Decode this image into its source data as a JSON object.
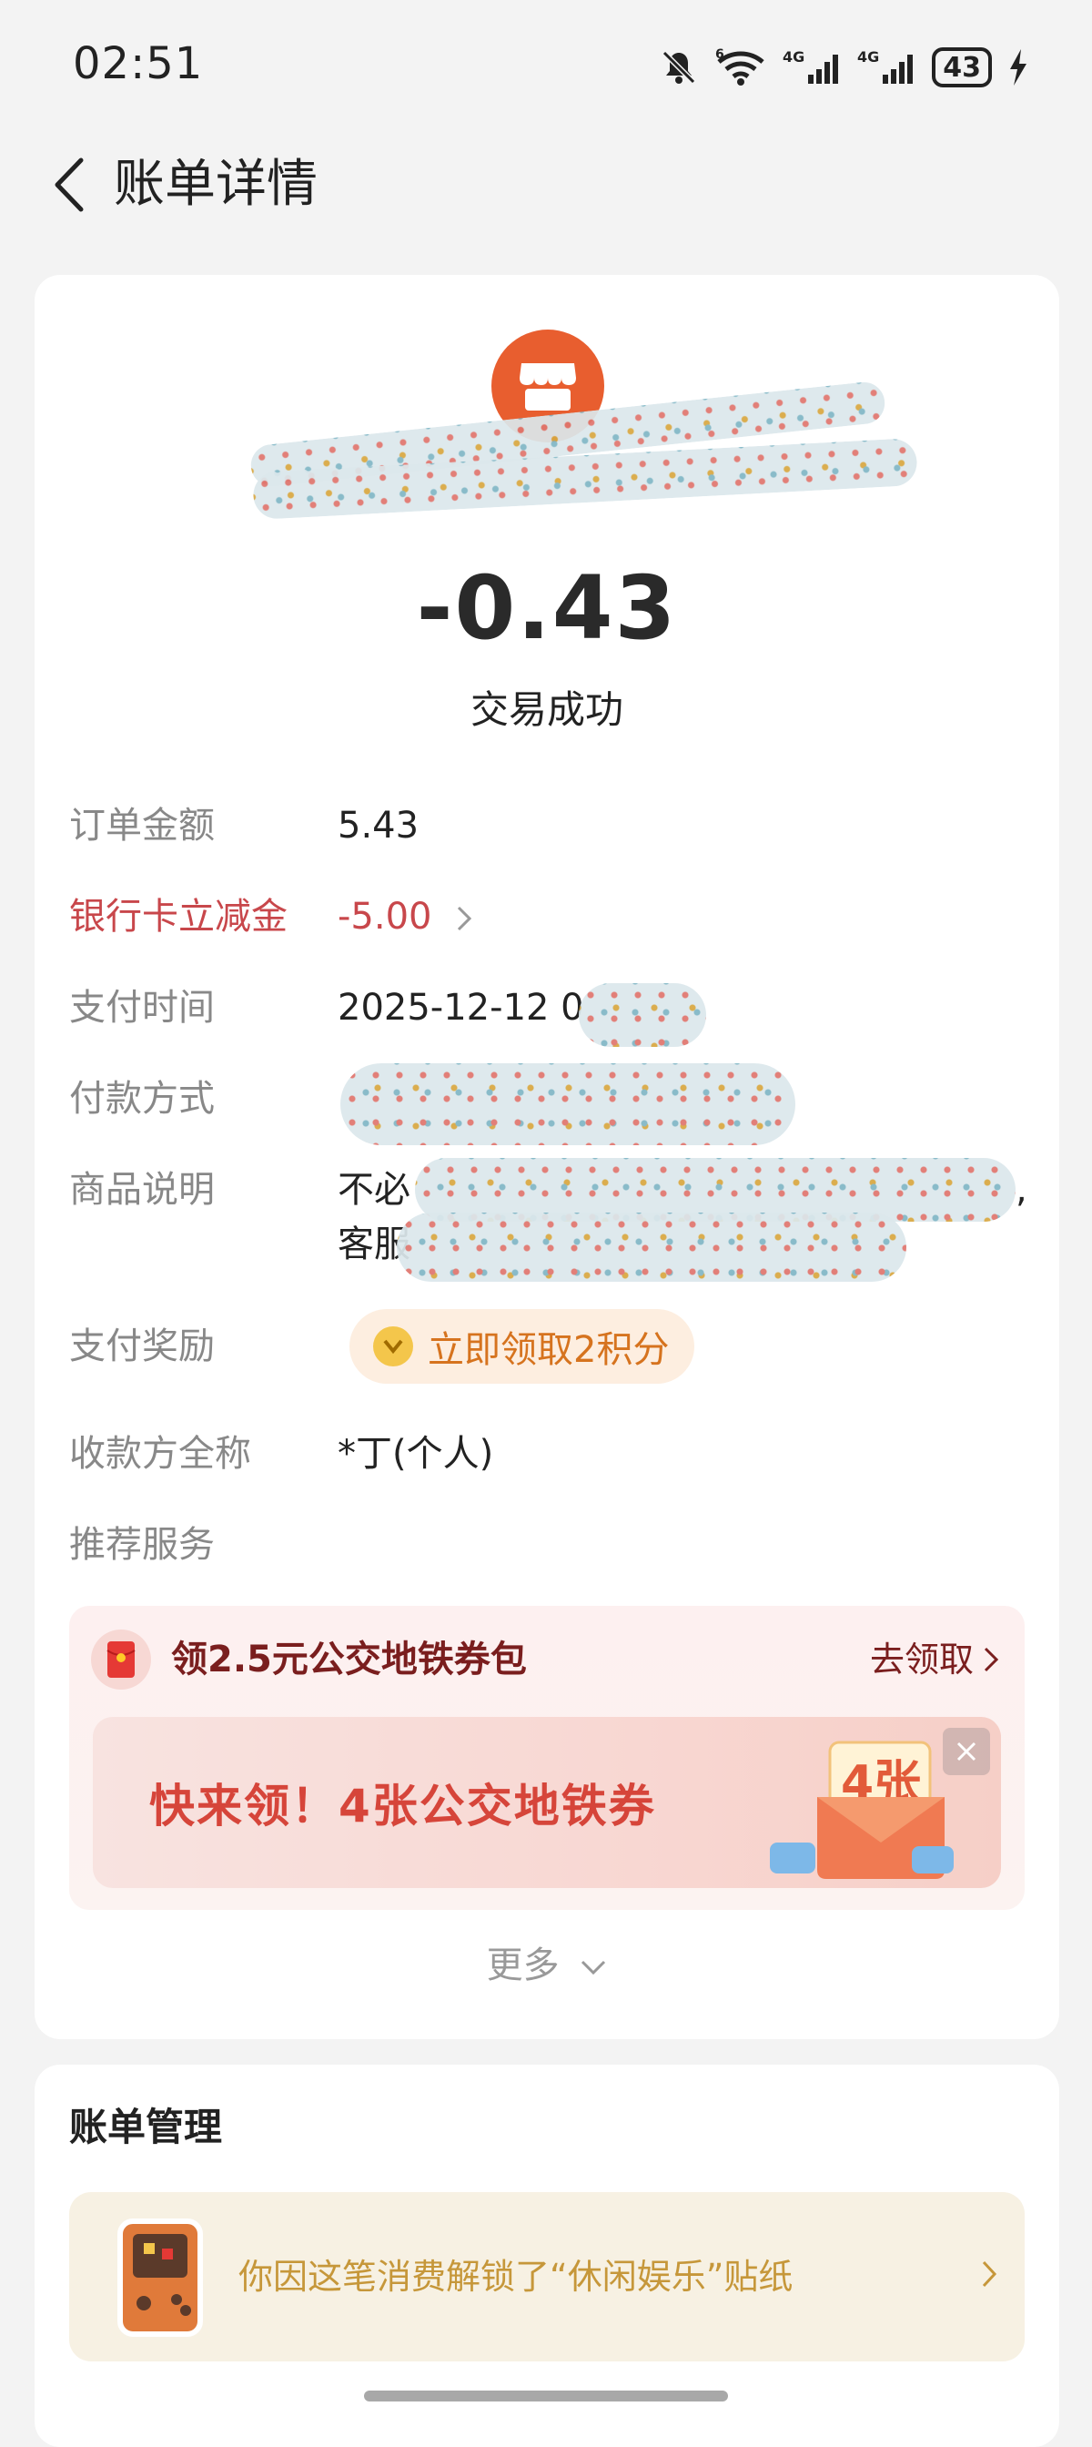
{
  "status_bar": {
    "time": "02:51",
    "battery": "43",
    "signal_label_1": "4G",
    "signal_label_2": "4G",
    "wifi_label": "6"
  },
  "header": {
    "title": "账单详情"
  },
  "transaction": {
    "amount": "-0.43",
    "status": "交易成功"
  },
  "details": {
    "order_amount_label": "订单金额",
    "order_amount_value": "5.43",
    "discount_label": "银行卡立减金",
    "discount_value": "-5.00",
    "pay_time_label": "支付时间",
    "pay_time_value": "2025-12-12 0",
    "pay_method_label": "付款方式",
    "pay_method_value": "",
    "goods_label": "商品说明",
    "goods_value_line1": "不必",
    "goods_value_line1_end": ",",
    "goods_value_line2": "客服",
    "reward_label": "支付奖励",
    "reward_button": "立即领取2积分",
    "payee_label": "收款方全称",
    "payee_value": "*丁(个人)",
    "recommend_label": "推荐服务"
  },
  "promo": {
    "title": "领2.5元公交地铁券包",
    "action": "去领取",
    "banner_text": "快来领！4张公交地铁券",
    "banner_badge": "4张"
  },
  "more_label": "更多",
  "manage": {
    "title": "账单管理",
    "sticker_text": "你因这笔消费解锁了“休闲娱乐”贴纸"
  },
  "colors": {
    "accent_red": "#c8474b",
    "merchant_orange": "#e85e2f",
    "reward_orange": "#d6731e",
    "promo_red": "#d6453a",
    "sticker_gold": "#c6973a"
  }
}
